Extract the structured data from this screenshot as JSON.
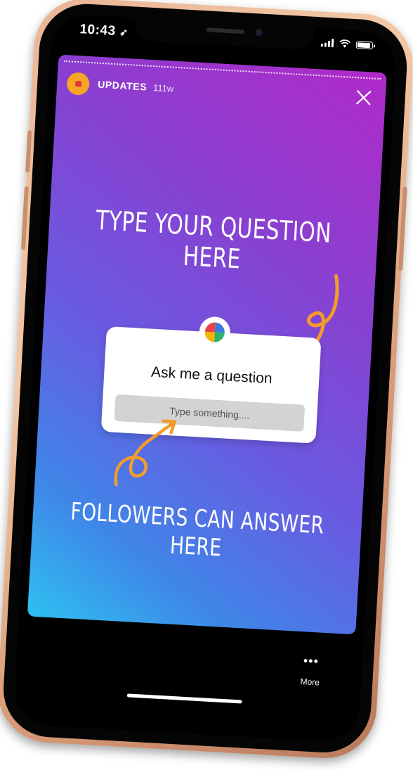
{
  "status_bar": {
    "time": "10:43",
    "location_glyph": "➶"
  },
  "story": {
    "account_name": "UPDATES",
    "posted_ago": "111w",
    "close_icon": "close-icon",
    "headline_top": "TYPE YOUR QUESTION HERE",
    "headline_bottom": "FOLLOWERS CAN ANSWER HERE",
    "question_sticker": {
      "title": "Ask me a question",
      "placeholder": "Type something...."
    }
  },
  "footer": {
    "more_icon": "•••",
    "more_label": "More"
  },
  "colors": {
    "frame_gold": "#e9b696",
    "avatar_bg": "#f5a623",
    "scribble": "#f39c2b",
    "gradient_top": "#b02ac8",
    "gradient_bottom": "#2ec0f0"
  }
}
